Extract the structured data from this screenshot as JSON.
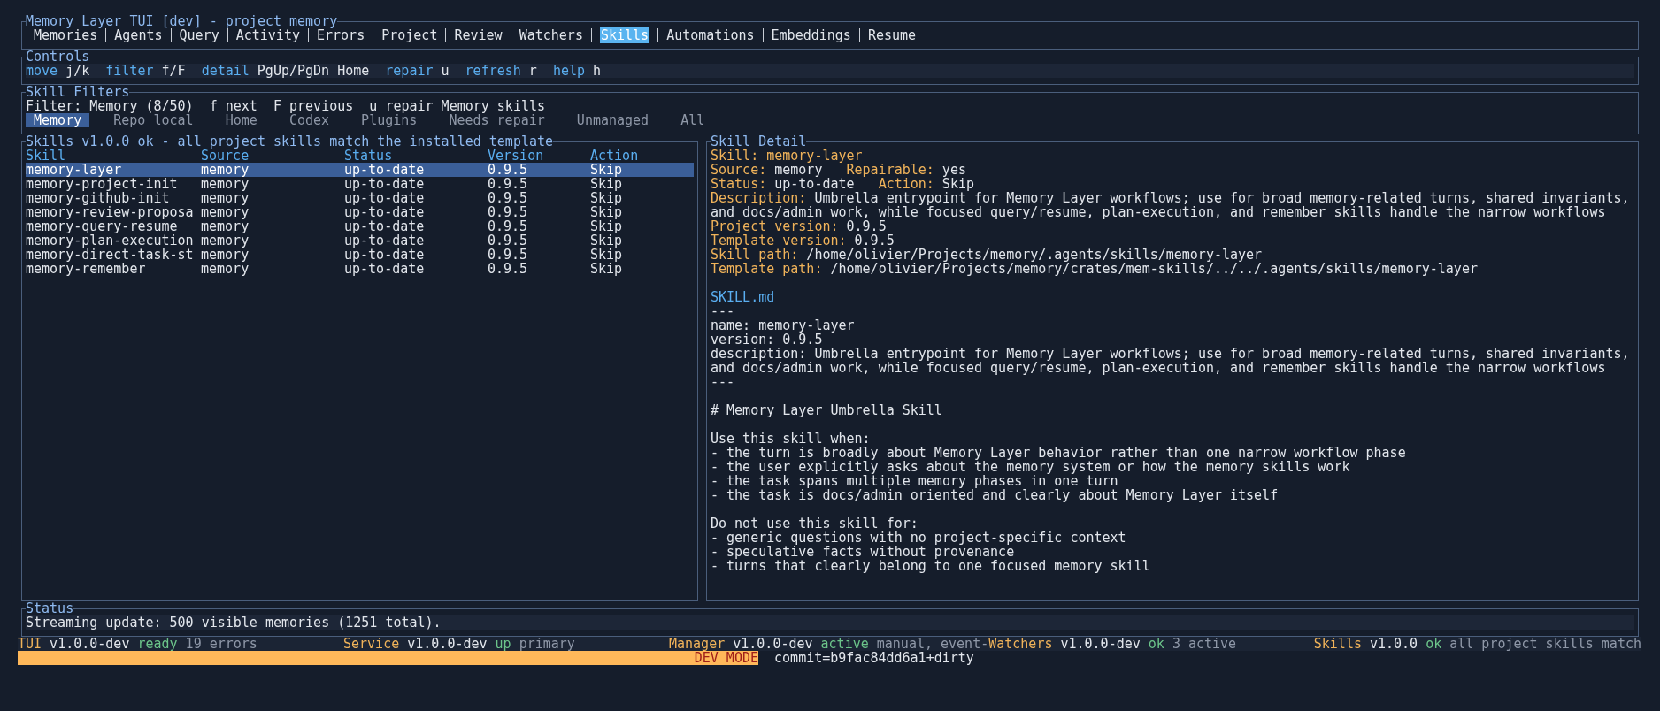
{
  "window": {
    "title": "Memory Layer TUI [dev] - project memory"
  },
  "tabs": [
    {
      "label": "Memories",
      "selected": false
    },
    {
      "label": "Agents",
      "selected": false
    },
    {
      "label": "Query",
      "selected": false
    },
    {
      "label": "Activity",
      "selected": false
    },
    {
      "label": "Errors",
      "selected": false
    },
    {
      "label": "Project",
      "selected": false
    },
    {
      "label": "Review",
      "selected": false
    },
    {
      "label": "Watchers",
      "selected": false
    },
    {
      "label": "Skills",
      "selected": true
    },
    {
      "label": "Automations",
      "selected": false
    },
    {
      "label": "Embeddings",
      "selected": false
    },
    {
      "label": "Resume",
      "selected": false
    }
  ],
  "controls": {
    "title": "Controls",
    "bindings": [
      {
        "action": "move",
        "key": "j/k"
      },
      {
        "action": "filter",
        "key": "f/F"
      },
      {
        "action": "detail",
        "key": "PgUp/PgDn Home"
      },
      {
        "action": "repair",
        "key": "u"
      },
      {
        "action": "refresh",
        "key": "r"
      },
      {
        "action": "help",
        "key": "h"
      }
    ]
  },
  "skill_filters": {
    "title": "Skill Filters",
    "summary": "Filter: Memory (8/50)  f next  F previous  u repair Memory skills",
    "filters": [
      {
        "label": "Memory",
        "selected": true
      },
      {
        "label": "Repo local",
        "selected": false
      },
      {
        "label": "Home",
        "selected": false
      },
      {
        "label": "Codex",
        "selected": false
      },
      {
        "label": "Plugins",
        "selected": false
      },
      {
        "label": "Needs repair",
        "selected": false
      },
      {
        "label": "Unmanaged",
        "selected": false
      },
      {
        "label": "All",
        "selected": false
      }
    ]
  },
  "skills_table": {
    "title": "Skills v1.0.0 ok - all project skills match the installed template",
    "columns": [
      "Skill",
      "Source",
      "Status",
      "Version",
      "Action"
    ],
    "rows": [
      {
        "cells": [
          "memory-layer",
          "memory",
          "up-to-date",
          "0.9.5",
          "Skip"
        ],
        "selected": true
      },
      {
        "cells": [
          "memory-project-init",
          "memory",
          "up-to-date",
          "0.9.5",
          "Skip"
        ],
        "selected": false
      },
      {
        "cells": [
          "memory-github-init",
          "memory",
          "up-to-date",
          "0.9.5",
          "Skip"
        ],
        "selected": false
      },
      {
        "cells": [
          "memory-review-proposa",
          "memory",
          "up-to-date",
          "0.9.5",
          "Skip"
        ],
        "selected": false
      },
      {
        "cells": [
          "memory-query-resume",
          "memory",
          "up-to-date",
          "0.9.5",
          "Skip"
        ],
        "selected": false
      },
      {
        "cells": [
          "memory-plan-execution",
          "memory",
          "up-to-date",
          "0.9.5",
          "Skip"
        ],
        "selected": false
      },
      {
        "cells": [
          "memory-direct-task-st",
          "memory",
          "up-to-date",
          "0.9.5",
          "Skip"
        ],
        "selected": false
      },
      {
        "cells": [
          "memory-remember",
          "memory",
          "up-to-date",
          "0.9.5",
          "Skip"
        ],
        "selected": false
      }
    ]
  },
  "skill_detail": {
    "title": "Skill Detail",
    "field_lines": [
      [
        {
          "label": "Skill:",
          "value": "memory-layer"
        }
      ],
      [
        {
          "label": "Source:",
          "value": "memory"
        },
        {
          "label": "Repairable:",
          "value": "yes"
        }
      ],
      [
        {
          "label": "Status:",
          "value": "up-to-date"
        },
        {
          "label": "Action:",
          "value": "Skip"
        }
      ],
      [
        {
          "label": "Description:",
          "value": "Umbrella entrypoint for Memory Layer workflows; use for broad memory-related turns, shared invariants,",
          "continuation": "and docs/admin work, while focused query/resume, plan-execution, and remember skills handle the narrow workflows"
        }
      ],
      [
        {
          "label": "Project version:",
          "value": "0.9.5"
        }
      ],
      [
        {
          "label": "Template version:",
          "value": "0.9.5"
        }
      ],
      [
        {
          "label": "Skill path:",
          "value": "/home/olivier/Projects/memory/.agents/skills/memory-layer"
        }
      ],
      [
        {
          "label": "Template path:",
          "value": "/home/olivier/Projects/memory/crates/mem-skills/../../.agents/skills/memory-layer"
        }
      ]
    ],
    "file_title": "SKILL.md",
    "file_blocks": [
      [
        "---",
        "name: memory-layer",
        "version: 0.9.5",
        "description: Umbrella entrypoint for Memory Layer workflows; use for broad memory-related turns, shared invariants,",
        "and docs/admin work, while focused query/resume, plan-execution, and remember skills handle the narrow workflows",
        "---"
      ],
      [
        "# Memory Layer Umbrella Skill"
      ],
      [
        "Use this skill when:",
        "- the turn is broadly about Memory Layer behavior rather than one narrow workflow phase",
        "- the user explicitly asks about the memory system or how the memory skills work",
        "- the task spans multiple memory phases in one turn",
        "- the task is docs/admin oriented and clearly about Memory Layer itself"
      ],
      [
        "Do not use this skill for:",
        "- generic questions with no project-specific context",
        "- speculative facts without provenance",
        "- turns that clearly belong to one focused memory skill"
      ]
    ]
  },
  "status": {
    "title": "Status",
    "message": "Streaming update: 500 visible memories (1251 total)."
  },
  "status_bar": [
    {
      "name": "TUI",
      "version": "v1.0.0-dev",
      "state": "ready",
      "note": "19 errors"
    },
    {
      "name": "Service",
      "version": "v1.0.0-dev",
      "state": "up",
      "note": "primary"
    },
    {
      "name": "Manager",
      "version": "v1.0.0-dev",
      "state": "active",
      "note": "manual, event-"
    },
    {
      "name": "Watchers",
      "version": "v1.0.0-dev",
      "state": "ok",
      "note": "3 active"
    },
    {
      "name": "Skills",
      "version": "v1.0.0",
      "state": "ok",
      "note": "all project skills match"
    }
  ],
  "dev_bar": {
    "label": "DEV MODE",
    "commit": "commit=b9fac84dd6a1+dirty"
  }
}
